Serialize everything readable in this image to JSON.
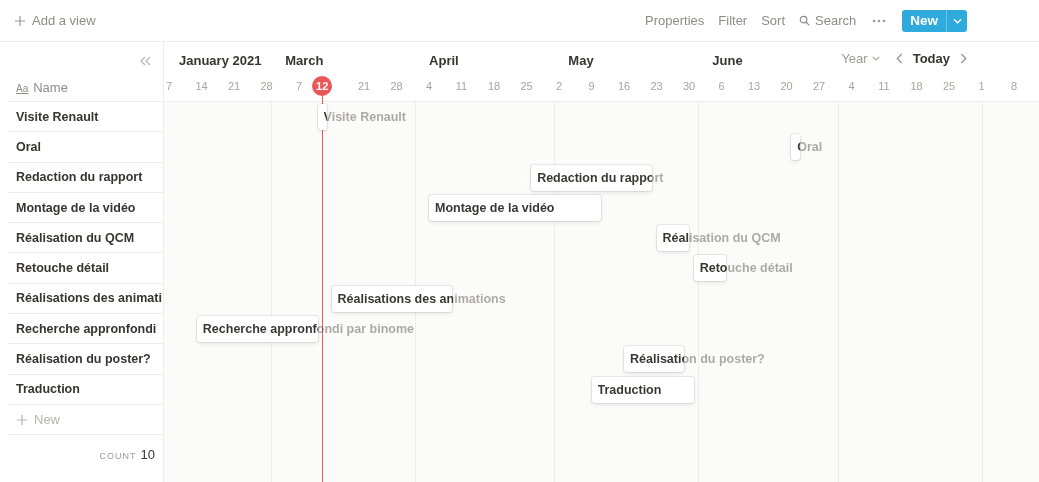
{
  "toolbar": {
    "add_view": "Add a view",
    "actions": [
      "Properties",
      "Filter",
      "Sort"
    ],
    "search": "Search",
    "new_button": "New"
  },
  "timeline": {
    "sticky_month": "January 2021",
    "today_label": "12",
    "zoom": "Year",
    "today_button": "Today",
    "months": [
      "March",
      "April",
      "May",
      "June"
    ],
    "ticks": [
      "7",
      "14",
      "21",
      "28",
      "7",
      "21",
      "28",
      "4",
      "11",
      "18",
      "25",
      "2",
      "9",
      "16",
      "23",
      "30",
      "6",
      "13",
      "20",
      "27",
      "4",
      "11",
      "18",
      "25",
      "1",
      "8"
    ]
  },
  "name_column": {
    "type_icon": "Aa",
    "heading": "Name"
  },
  "rows": [
    {
      "name": "Visite Renault",
      "bar_label": "Visite Renault"
    },
    {
      "name": "Oral",
      "bar_label": "Oral"
    },
    {
      "name": "Redaction du rapport",
      "bar_label": "Redaction du rapport"
    },
    {
      "name": "Montage de la vidéo",
      "bar_label": "Montage de la vidéo"
    },
    {
      "name": "Réalisation du QCM",
      "bar_label": "Réalisation du QCM"
    },
    {
      "name": "Retouche détail",
      "bar_label": "Retouche détail"
    },
    {
      "name": "Réalisations des animati",
      "bar_label": "Réalisations des animations"
    },
    {
      "name": "Recherche appronfondi",
      "bar_label": "Recherche appronfondi par binome"
    },
    {
      "name": "Réalisation du poster?",
      "bar_label": "Réalisation du poster?"
    },
    {
      "name": "Traduction",
      "bar_label": "Traduction"
    }
  ],
  "new_row": "New",
  "count": {
    "label": "COUNT",
    "value": "10"
  }
}
